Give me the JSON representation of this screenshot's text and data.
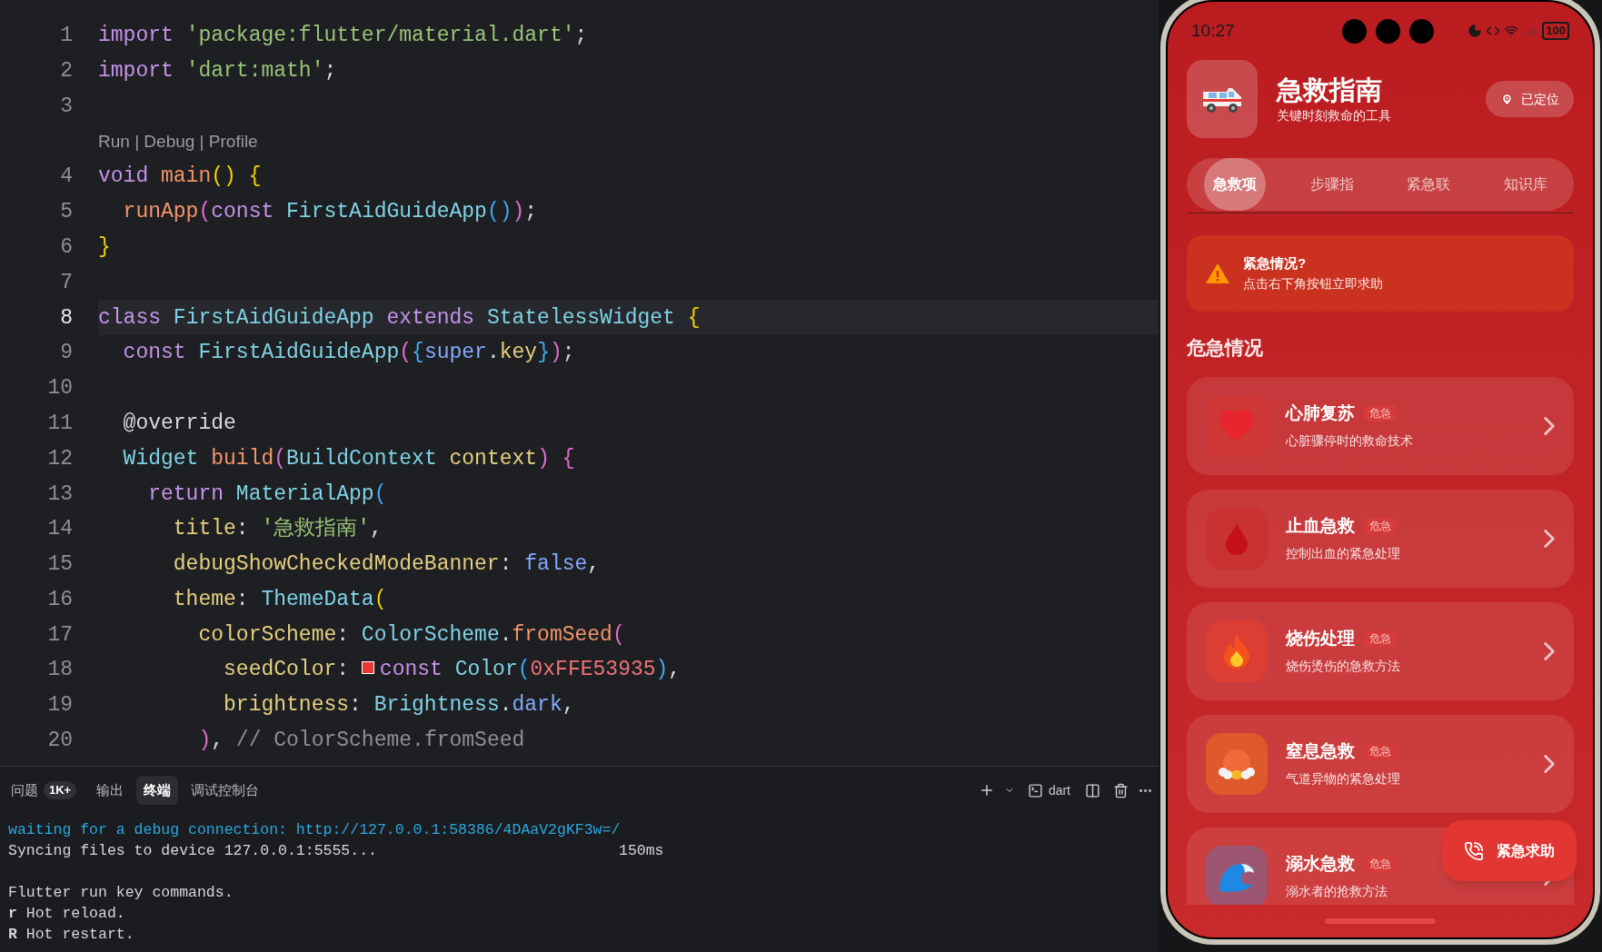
{
  "editor": {
    "lines": [
      {
        "number": "1",
        "tokens": [
          {
            "kind": "kw",
            "text": "import "
          },
          {
            "kind": "str",
            "text": "'package:flutter/material.dart'"
          },
          {
            "kind": "plain",
            "text": ";"
          }
        ]
      },
      {
        "number": "2",
        "tokens": [
          {
            "kind": "kw",
            "text": "import "
          },
          {
            "kind": "str",
            "text": "'dart:math'"
          },
          {
            "kind": "plain",
            "text": ";"
          }
        ]
      },
      {
        "number": "3"
      },
      {
        "number": "4",
        "codelens": "Run | Debug | Profile",
        "tokens": [
          {
            "kind": "kw",
            "text": "void "
          },
          {
            "kind": "fn",
            "text": "main"
          },
          {
            "kind": "br1",
            "text": "() {"
          }
        ]
      },
      {
        "number": "5",
        "tokens": [
          {
            "kind": "fn",
            "text": "  runApp"
          },
          {
            "kind": "br2",
            "text": "("
          },
          {
            "kind": "kw",
            "text": "const "
          },
          {
            "kind": "type",
            "text": "FirstAidGuideApp"
          },
          {
            "kind": "br3",
            "text": "()"
          },
          {
            "kind": "br2",
            "text": ")"
          },
          {
            "kind": "plain",
            "text": ";"
          }
        ]
      },
      {
        "number": "6",
        "tokens": [
          {
            "kind": "br1",
            "text": "}"
          }
        ]
      },
      {
        "number": "7"
      },
      {
        "number": "8",
        "current": true,
        "tokens": [
          {
            "kind": "kw",
            "text": "class "
          },
          {
            "kind": "type",
            "text": "FirstAidGuideApp "
          },
          {
            "kind": "kw",
            "text": "extends "
          },
          {
            "kind": "type",
            "text": "StatelessWidget "
          },
          {
            "kind": "br1",
            "text": "{"
          }
        ]
      },
      {
        "number": "9",
        "tokens": [
          {
            "kind": "kw",
            "text": "  const "
          },
          {
            "kind": "type",
            "text": "FirstAidGuideApp"
          },
          {
            "kind": "br2",
            "text": "("
          },
          {
            "kind": "br3",
            "text": "{"
          },
          {
            "kind": "bool",
            "text": "super"
          },
          {
            "kind": "plain",
            "text": "."
          },
          {
            "kind": "prop",
            "text": "key"
          },
          {
            "kind": "br3",
            "text": "}"
          },
          {
            "kind": "br2",
            "text": ")"
          },
          {
            "kind": "plain",
            "text": ";"
          }
        ]
      },
      {
        "number": "10"
      },
      {
        "number": "11",
        "tokens": [
          {
            "kind": "plain",
            "text": "  @override"
          }
        ]
      },
      {
        "number": "12",
        "tokens": [
          {
            "kind": "type",
            "text": "  Widget "
          },
          {
            "kind": "fn",
            "text": "build"
          },
          {
            "kind": "br2",
            "text": "("
          },
          {
            "kind": "type",
            "text": "BuildContext "
          },
          {
            "kind": "prop",
            "text": "context"
          },
          {
            "kind": "br2",
            "text": ") {"
          }
        ]
      },
      {
        "number": "13",
        "tokens": [
          {
            "kind": "kw",
            "text": "    return "
          },
          {
            "kind": "type",
            "text": "MaterialApp"
          },
          {
            "kind": "br3",
            "text": "("
          }
        ]
      },
      {
        "number": "14",
        "tokens": [
          {
            "kind": "prop",
            "text": "      title"
          },
          {
            "kind": "plain",
            "text": ": "
          },
          {
            "kind": "str",
            "text": "'急救指南'"
          },
          {
            "kind": "plain",
            "text": ","
          }
        ]
      },
      {
        "number": "15",
        "tokens": [
          {
            "kind": "prop",
            "text": "      debugShowCheckedModeBanner"
          },
          {
            "kind": "plain",
            "text": ": "
          },
          {
            "kind": "bool",
            "text": "false"
          },
          {
            "kind": "plain",
            "text": ","
          }
        ]
      },
      {
        "number": "16",
        "tokens": [
          {
            "kind": "prop",
            "text": "      theme"
          },
          {
            "kind": "plain",
            "text": ": "
          },
          {
            "kind": "type",
            "text": "ThemeData"
          },
          {
            "kind": "br1",
            "text": "("
          }
        ]
      },
      {
        "number": "17",
        "tokens": [
          {
            "kind": "prop",
            "text": "        colorScheme"
          },
          {
            "kind": "plain",
            "text": ": "
          },
          {
            "kind": "type",
            "text": "ColorScheme"
          },
          {
            "kind": "plain",
            "text": "."
          },
          {
            "kind": "fn",
            "text": "fromSeed"
          },
          {
            "kind": "br2",
            "text": "("
          }
        ]
      },
      {
        "number": "18",
        "tokens": [
          {
            "kind": "prop",
            "text": "          seedColor"
          },
          {
            "kind": "plain",
            "text": ": "
          },
          {
            "kind": "swatch",
            "color": "#e53935"
          },
          {
            "kind": "kw",
            "text": "const "
          },
          {
            "kind": "type",
            "text": "Color"
          },
          {
            "kind": "br3",
            "text": "("
          },
          {
            "kind": "num",
            "text": "0xFFE53935"
          },
          {
            "kind": "br3",
            "text": ")"
          },
          {
            "kind": "plain",
            "text": ","
          }
        ]
      },
      {
        "number": "19",
        "tokens": [
          {
            "kind": "prop",
            "text": "          brightness"
          },
          {
            "kind": "plain",
            "text": ": "
          },
          {
            "kind": "type",
            "text": "Brightness"
          },
          {
            "kind": "plain",
            "text": "."
          },
          {
            "kind": "bool",
            "text": "dark"
          },
          {
            "kind": "plain",
            "text": ","
          }
        ]
      },
      {
        "number": "20",
        "tokens": [
          {
            "kind": "br2",
            "text": "        )"
          },
          {
            "kind": "plain",
            "text": ", "
          },
          {
            "kind": "cmt",
            "text": "// ColorScheme.fromSeed"
          }
        ]
      }
    ]
  },
  "panel": {
    "tabs": [
      {
        "label": "问题",
        "badge": "1K+",
        "selected": false
      },
      {
        "label": "输出",
        "selected": false
      },
      {
        "label": "终端",
        "selected": true
      },
      {
        "label": "调试控制台",
        "selected": false
      }
    ],
    "shell": "dart",
    "terminal": [
      {
        "kind": "link",
        "text": "waiting for a debug connection: http://127.0.0.1:58386/4DAaV2gKF3w=/"
      },
      {
        "kind": "plain",
        "text": "Syncing files to device 127.0.0.1:5555...",
        "right": "150ms"
      },
      {
        "kind": "plain",
        "text": "Flutter run key commands.",
        "space_before": true
      },
      {
        "kind": "plain",
        "text": "**r** Hot reload."
      },
      {
        "kind": "plain",
        "text": "**R** Hot restart."
      }
    ]
  },
  "phone": {
    "status": {
      "time": "10:27",
      "battery": "100"
    },
    "header": {
      "title": "急救指南",
      "subtitle": "关键时刻救命的工具",
      "location": "已定位"
    },
    "tabs": [
      {
        "label": "急救项",
        "selected": true
      },
      {
        "label": "步骤指",
        "selected": false
      },
      {
        "label": "紧急联",
        "selected": false
      },
      {
        "label": "知识库",
        "selected": false
      }
    ],
    "alert": {
      "title": "紧急情况?",
      "text": "点击右下角按钮立即求助"
    },
    "section_title": "危急情况",
    "cards": [
      {
        "kind": "heart",
        "color": "#cf3636",
        "title": "心肺复苏",
        "badge": "危急",
        "subtitle": "心脏骤停时的救命技术"
      },
      {
        "kind": "drop",
        "color": "#c93232",
        "title": "止血急救",
        "badge": "危急",
        "subtitle": "控制出血的紧急处理"
      },
      {
        "kind": "fire",
        "color": "#dc3e34",
        "title": "烧伤处理",
        "badge": "危急",
        "subtitle": "烧伤烫伤的急救方法"
      },
      {
        "kind": "puff",
        "color": "#de5a2c",
        "title": "窒息急救",
        "badge": "危急",
        "subtitle": "气道异物的紧急处理"
      },
      {
        "kind": "wave",
        "color": "#9d5672",
        "title": "溺水急救",
        "badge": "危急",
        "subtitle": "溺水者的抢救方法"
      }
    ],
    "fab": "紧急求助"
  }
}
